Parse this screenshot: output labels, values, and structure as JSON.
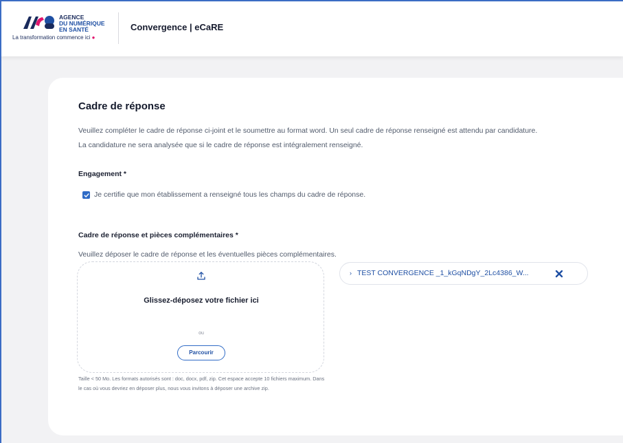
{
  "header": {
    "logo_line1": "AGENCE",
    "logo_line2": "DU NUMÉRIQUE",
    "logo_line3": "EN SANTÉ",
    "logo_tagline": "La transformation commence ici",
    "app_title": "Convergence | eCaRE"
  },
  "section": {
    "title": "Cadre de réponse",
    "description_line1": "Veuillez compléter le cadre de réponse ci-joint et le soumettre au format word. Un seul cadre de réponse renseigné est attendu par candidature.",
    "description_line2": "La candidature ne sera analysée que si le cadre de réponse est intégralement renseigné."
  },
  "engagement": {
    "label": "Engagement *",
    "checkbox_checked": true,
    "checkbox_label": "Je certifie que mon établissement a renseigné tous les champs du cadre de réponse."
  },
  "upload": {
    "label": "Cadre de réponse et pièces complémentaires *",
    "hint": "Veuillez déposer le cadre de réponse et les éventuelles pièces complémentaires.",
    "dropzone_title": "Glissez-déposez votre fichier ici",
    "dropzone_or": "ou",
    "browse_label": "Parcourir",
    "size_note": "Taille < 50 Mo. Les formats autorisés sont : doc, docx, pdf, zip. Cet espace accepte 10 fichiers maximum. Dans le cas où vous devriez en déposer plus, nous vous invitons à déposer une archive zip.",
    "files": [
      {
        "name": "TEST CONVERGENCE _1_kGqNDgY_2Lc4386_W..."
      }
    ]
  },
  "colors": {
    "accent": "#2f6bc6",
    "brand_navy": "#1a2b5c",
    "brand_pink": "#e1146c",
    "background": "#f2f2f4"
  }
}
